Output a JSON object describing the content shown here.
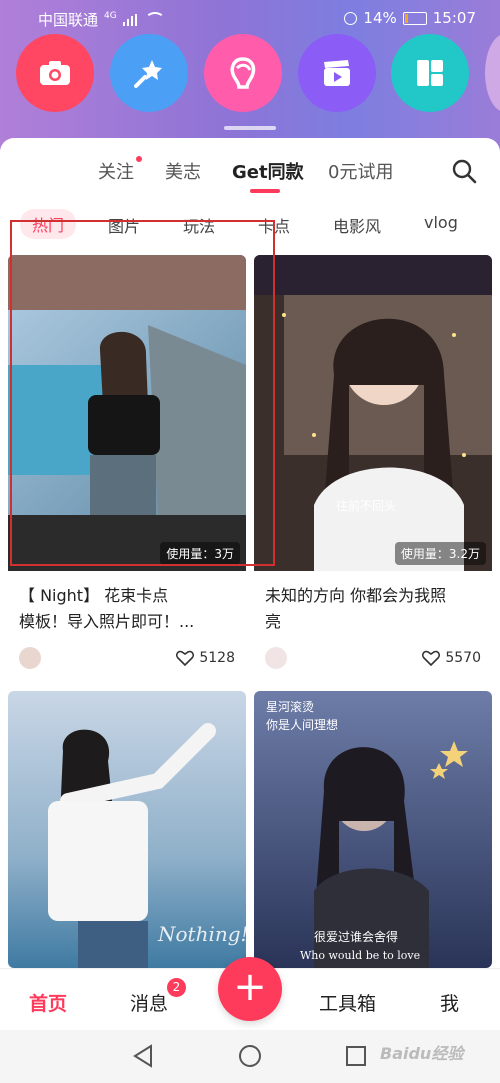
{
  "status_bar": {
    "carrier": "中国联通",
    "network": "4G",
    "battery_percent": "14%",
    "time": "15:07"
  },
  "tools": [
    {
      "icon": "camera-icon",
      "color": "#ff4763"
    },
    {
      "icon": "magic-wand-icon",
      "color": "#4b9ff5"
    },
    {
      "icon": "beauty-face-icon",
      "color": "#ff5dab"
    },
    {
      "icon": "video-clapper-icon",
      "color": "#8b5cf6"
    },
    {
      "icon": "layout-grid-icon",
      "color": "#22c7c7"
    }
  ],
  "top_tabs": [
    {
      "label": "关注",
      "has_dot": true
    },
    {
      "label": "美志"
    },
    {
      "label": "Get同款",
      "active": true
    },
    {
      "label": "0元试用"
    }
  ],
  "categories": [
    {
      "label": "热门",
      "active": true
    },
    {
      "label": "图片"
    },
    {
      "label": "玩法"
    },
    {
      "label": "卡点"
    },
    {
      "label": "电影风"
    },
    {
      "label": "vlog"
    }
  ],
  "cards": [
    {
      "usage": "使用量：3万",
      "title_line1": "【   Night】 花束卡点",
      "title_line2": "模板！导入照片即可！...",
      "likes": "5128"
    },
    {
      "usage": "使用量：3.2万",
      "title_line1": "未知的方向 你都会为我照",
      "title_line2": "亮",
      "likes": "5570",
      "overlay_text": "往前不回头"
    },
    {
      "overlay_text": "Nothing!"
    },
    {
      "overlay_top_line1": "星河滚烫",
      "overlay_top_line2": "你是人间理想",
      "overlay_bottom_line1": "很爱过谁会舍得",
      "overlay_bottom_line2": "Who would be to love"
    }
  ],
  "bottom_nav": {
    "home": "首页",
    "messages": "消息",
    "messages_badge": "2",
    "publish": "+",
    "toolbox": "工具箱",
    "me": "我"
  },
  "watermark": "Baidu经验",
  "colors": {
    "accent": "#ff3b5c",
    "selection_box": "#d0302f"
  }
}
